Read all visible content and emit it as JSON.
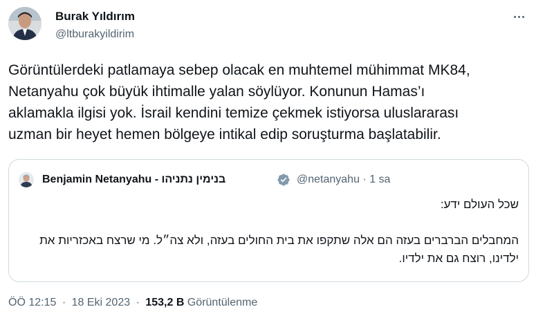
{
  "author": {
    "name": "Burak Yıldırım",
    "handle": "@ltburakyildirim"
  },
  "tweet": {
    "lines": [
      "Görüntülerdeki patlamaya sebep olacak en muhtemel mühimmat MK84,",
      "Netanyahu çok büyük ihtimalle yalan söylüyor. Konunun Hamas’ı",
      "aklamakla ilgisi yok. İsrail kendini temize çekmek istiyorsa uluslararası",
      "uzman bir heyet hemen bölgeye intikal edip soruşturma başlatabilir."
    ]
  },
  "quoted": {
    "name": "Benjamin Netanyahu - בנימין נתניהו",
    "handle": "@netanyahu · 1 sa",
    "paragraph1": "שכל העולם ידע:",
    "paragraph2": "המחבלים הברברים בעזה הם אלה שתקפו את בית החולים בעזה, ולא צה״ל. מי שרצח באכזריות את ילדינו, רוצח גם את ילדיו."
  },
  "meta": {
    "time": "ÖÖ 12:15",
    "separator": "·",
    "date": "18 Eki 2023",
    "views": "153,2 B",
    "views_label": "Görüntülenme"
  },
  "icons": {
    "more": "more-horizontal-icon",
    "verified": "gray-verified-badge-icon"
  },
  "colors": {
    "text": "#0f1419",
    "secondary": "#536471",
    "border": "#cfd9de",
    "verified_gray": "#829aab"
  }
}
